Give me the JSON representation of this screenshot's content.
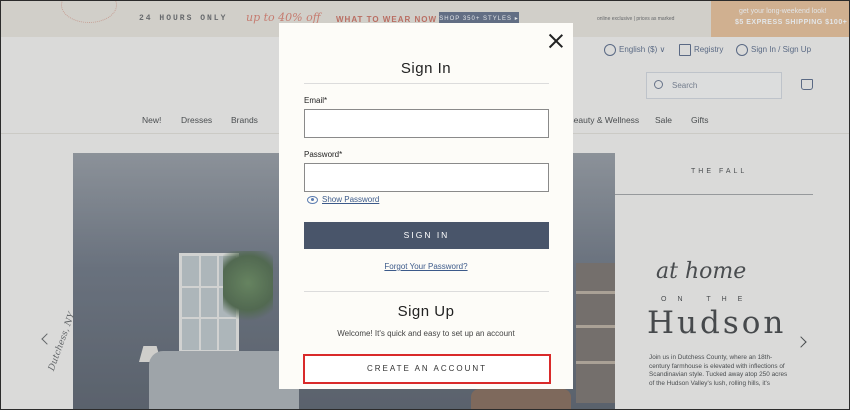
{
  "promo": {
    "hours": "24 HOURS ONLY",
    "offer": "up to 40% off",
    "wear": "WHAT TO WEAR NOW",
    "styles_button": "SHOP 350+ STYLES ▸",
    "exclusive": "online exclusive | prices as marked",
    "shipping_line1": "get your long-weekend look!",
    "shipping_line2": "$5 EXPRESS SHIPPING $100+"
  },
  "header": {
    "language": "English ($) ∨",
    "registry": "Registry",
    "sign_in": "Sign In / Sign Up",
    "search_placeholder": "Search",
    "nav": [
      "New!",
      "Dresses",
      "Brands",
      "Beauty & Wellness",
      "Sale",
      "Gifts"
    ]
  },
  "hero": {
    "script_text": "Dutchess, NY",
    "the_fall": "THE FALL",
    "at_home": "at home",
    "on_the": "ON THE",
    "hudson": "Hudson",
    "paragraph": "Join us in Dutchess County, where an 18th-century farmhouse is elevated with inflections of Scandinavian style. Tucked away atop 250 acres of the Hudson Valley's lush, rolling hills, it's"
  },
  "modal": {
    "sign_in_title": "Sign In",
    "email_label": "Email*",
    "email_value": "",
    "password_label": "Password*",
    "password_value": "",
    "show_password": "Show Password",
    "sign_in_button": "SIGN IN",
    "forgot_password": "Forgot Your Password?",
    "sign_up_title": "Sign Up",
    "welcome_text": "Welcome! It's quick and easy to set up an account",
    "create_account_button": "CREATE AN ACCOUNT"
  },
  "colors": {
    "primary_button": "#49556a",
    "highlight_border": "#d92a2a",
    "link": "#3c5a8a"
  }
}
